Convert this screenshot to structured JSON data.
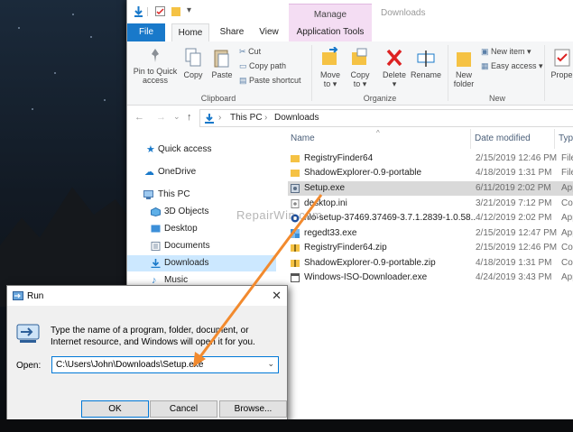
{
  "explorer": {
    "contextual_tab": "Manage",
    "window_title": "Downloads",
    "tabs": [
      "File",
      "Home",
      "Share",
      "View",
      "Application Tools"
    ],
    "ribbon": {
      "clipboard": {
        "pin": "Pin to Quick access",
        "copy": "Copy",
        "paste": "Paste",
        "cut": "Cut",
        "copy_path": "Copy path",
        "paste_shortcut": "Paste shortcut",
        "group": "Clipboard"
      },
      "organize": {
        "move_to": "Move to ▾",
        "copy_to": "Copy to ▾",
        "delete": "Delete",
        "delete_caret": "▾",
        "rename": "Rename",
        "group": "Organize"
      },
      "new": {
        "new_folder": "New folder",
        "new_item": "New item ▾",
        "easy_access": "Easy access ▾",
        "group": "New"
      },
      "open": {
        "properties": "Prope"
      }
    },
    "address": {
      "crumbs": [
        "This PC",
        "Downloads"
      ]
    },
    "nav": [
      {
        "label": "Quick access",
        "icon": "star-icon"
      },
      {
        "label": "OneDrive",
        "icon": "cloud-icon"
      },
      {
        "label": "This PC",
        "icon": "computer-icon"
      },
      {
        "label": "3D Objects",
        "icon": "cube-icon"
      },
      {
        "label": "Desktop",
        "icon": "desktop-icon"
      },
      {
        "label": "Documents",
        "icon": "documents-icon"
      },
      {
        "label": "Downloads",
        "icon": "download-icon",
        "selected": true
      },
      {
        "label": "Music",
        "icon": "music-icon"
      }
    ],
    "columns": {
      "name": "Name",
      "date": "Date modified",
      "type": "Typ"
    },
    "files": [
      {
        "name": "RegistryFinder64",
        "date": "2/15/2019 12:46 PM",
        "type": "File",
        "icon": "folder-icon"
      },
      {
        "name": "ShadowExplorer-0.9-portable",
        "date": "4/18/2019 1:31 PM",
        "type": "File",
        "icon": "folder-icon"
      },
      {
        "name": "Setup.exe",
        "date": "6/11/2019 2:02 PM",
        "type": "App",
        "icon": "setup-exe-icon",
        "selected": true
      },
      {
        "name": "desktop.ini",
        "date": "3/21/2019 7:12 PM",
        "type": "Con",
        "icon": "ini-file-icon"
      },
      {
        "name": "nlo-setup-37469.37469-3.7.1.2839-1.0.58...",
        "date": "4/12/2019 2:02 PM",
        "type": "App",
        "icon": "installer-icon"
      },
      {
        "name": "regedt33.exe",
        "date": "2/15/2019 12:47 PM",
        "type": "App",
        "icon": "regedit-icon"
      },
      {
        "name": "RegistryFinder64.zip",
        "date": "2/15/2019 12:46 PM",
        "type": "Com",
        "icon": "zip-icon"
      },
      {
        "name": "ShadowExplorer-0.9-portable.zip",
        "date": "4/18/2019 1:31 PM",
        "type": "Com",
        "icon": "zip-icon"
      },
      {
        "name": "Windows-ISO-Downloader.exe",
        "date": "4/24/2019 3:43 PM",
        "type": "App",
        "icon": "app-icon"
      }
    ]
  },
  "watermark": "RepairWin.com",
  "run_dialog": {
    "title": "Run",
    "close": "✕",
    "description": "Type the name of a program, folder, document, or Internet resource, and Windows will open it for you.",
    "open_label": "Open:",
    "open_value": "C:\\Users\\John\\Downloads\\Setup.exe",
    "ok": "OK",
    "cancel": "Cancel",
    "browse": "Browse..."
  },
  "colors": {
    "accent": "#1979ca",
    "context_tab": "#f4ddf3",
    "selection": "#cce8ff",
    "arrow": "#f28a2e"
  }
}
